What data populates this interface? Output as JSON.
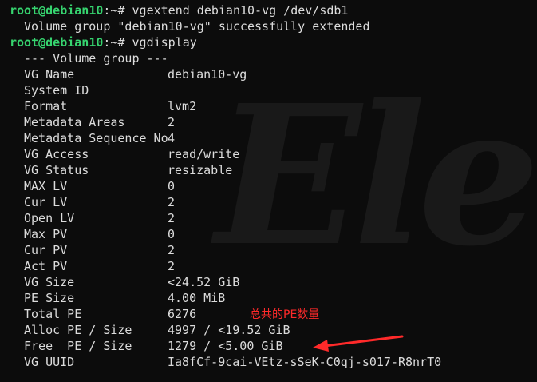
{
  "prompt": {
    "user_host": "root@debian10",
    "path": ":~",
    "symbol": "# "
  },
  "cmd1": "vgextend debian10-vg /dev/sdb1",
  "cmd1_output": "Volume group \"debian10-vg\" successfully extended",
  "cmd2": "vgdisplay",
  "vg_header": "--- Volume group ---",
  "vg_fields": [
    {
      "key": "VG Name",
      "value": "debian10-vg"
    },
    {
      "key": "System ID",
      "value": ""
    },
    {
      "key": "Format",
      "value": "lvm2"
    },
    {
      "key": "Metadata Areas",
      "value": "2"
    },
    {
      "key": "Metadata Sequence No",
      "value": "4"
    },
    {
      "key": "VG Access",
      "value": "read/write"
    },
    {
      "key": "VG Status",
      "value": "resizable"
    },
    {
      "key": "MAX LV",
      "value": "0"
    },
    {
      "key": "Cur LV",
      "value": "2"
    },
    {
      "key": "Open LV",
      "value": "2"
    },
    {
      "key": "Max PV",
      "value": "0"
    },
    {
      "key": "Cur PV",
      "value": "2"
    },
    {
      "key": "Act PV",
      "value": "2"
    },
    {
      "key": "VG Size",
      "value": "<24.52 GiB"
    },
    {
      "key": "PE Size",
      "value": "4.00 MiB"
    },
    {
      "key": "Total PE",
      "value": "6276"
    },
    {
      "key": "Alloc PE / Size",
      "value": "4997 / <19.52 GiB"
    },
    {
      "key": "Free  PE / Size",
      "value": "1279 / <5.00 GiB"
    },
    {
      "key": "VG UUID",
      "value": "Ia8fCf-9cai-VEtz-sSeK-C0qj-s017-R8nrT0"
    }
  ],
  "annotation": {
    "text": "总共的PE数量",
    "color": "#ff2a2a"
  },
  "watermark": "Elec",
  "colors": {
    "background": "#0c0c0c",
    "foreground": "#dcdcdc",
    "prompt_user": "#36d46f",
    "prompt_path": "#4a8cff",
    "annotation": "#ff2a2a"
  }
}
